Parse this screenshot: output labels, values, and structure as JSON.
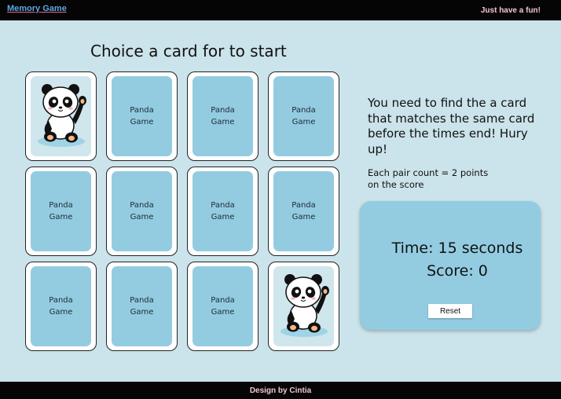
{
  "header": {
    "brand": "Memory Game",
    "tagline": "Just have a fun!"
  },
  "board": {
    "title": "Choice a card for to start",
    "card_back_line1": "Panda",
    "card_back_line2": "Game",
    "cards": [
      {
        "state": "revealed",
        "image": "panda-icon"
      },
      {
        "state": "hidden"
      },
      {
        "state": "hidden"
      },
      {
        "state": "hidden"
      },
      {
        "state": "hidden"
      },
      {
        "state": "hidden"
      },
      {
        "state": "hidden"
      },
      {
        "state": "hidden"
      },
      {
        "state": "hidden"
      },
      {
        "state": "hidden"
      },
      {
        "state": "hidden"
      },
      {
        "state": "revealed",
        "image": "panda-icon"
      }
    ]
  },
  "info": {
    "instructions": "You need to find the a card that matches the same card before the times end! Hury up!",
    "note_line1": "Each pair count = 2 points",
    "note_line2": "on the score"
  },
  "status": {
    "time": "Time: 15 seconds",
    "score": "Score: 0",
    "reset_label": "Reset"
  },
  "footer": {
    "credit": "Design by Cintia"
  },
  "colors": {
    "background": "#cbe3ea",
    "card_back": "#93cce1",
    "bars": "#050505",
    "accent_text": "#f3c4d4",
    "brand": "#5aa7e8"
  }
}
